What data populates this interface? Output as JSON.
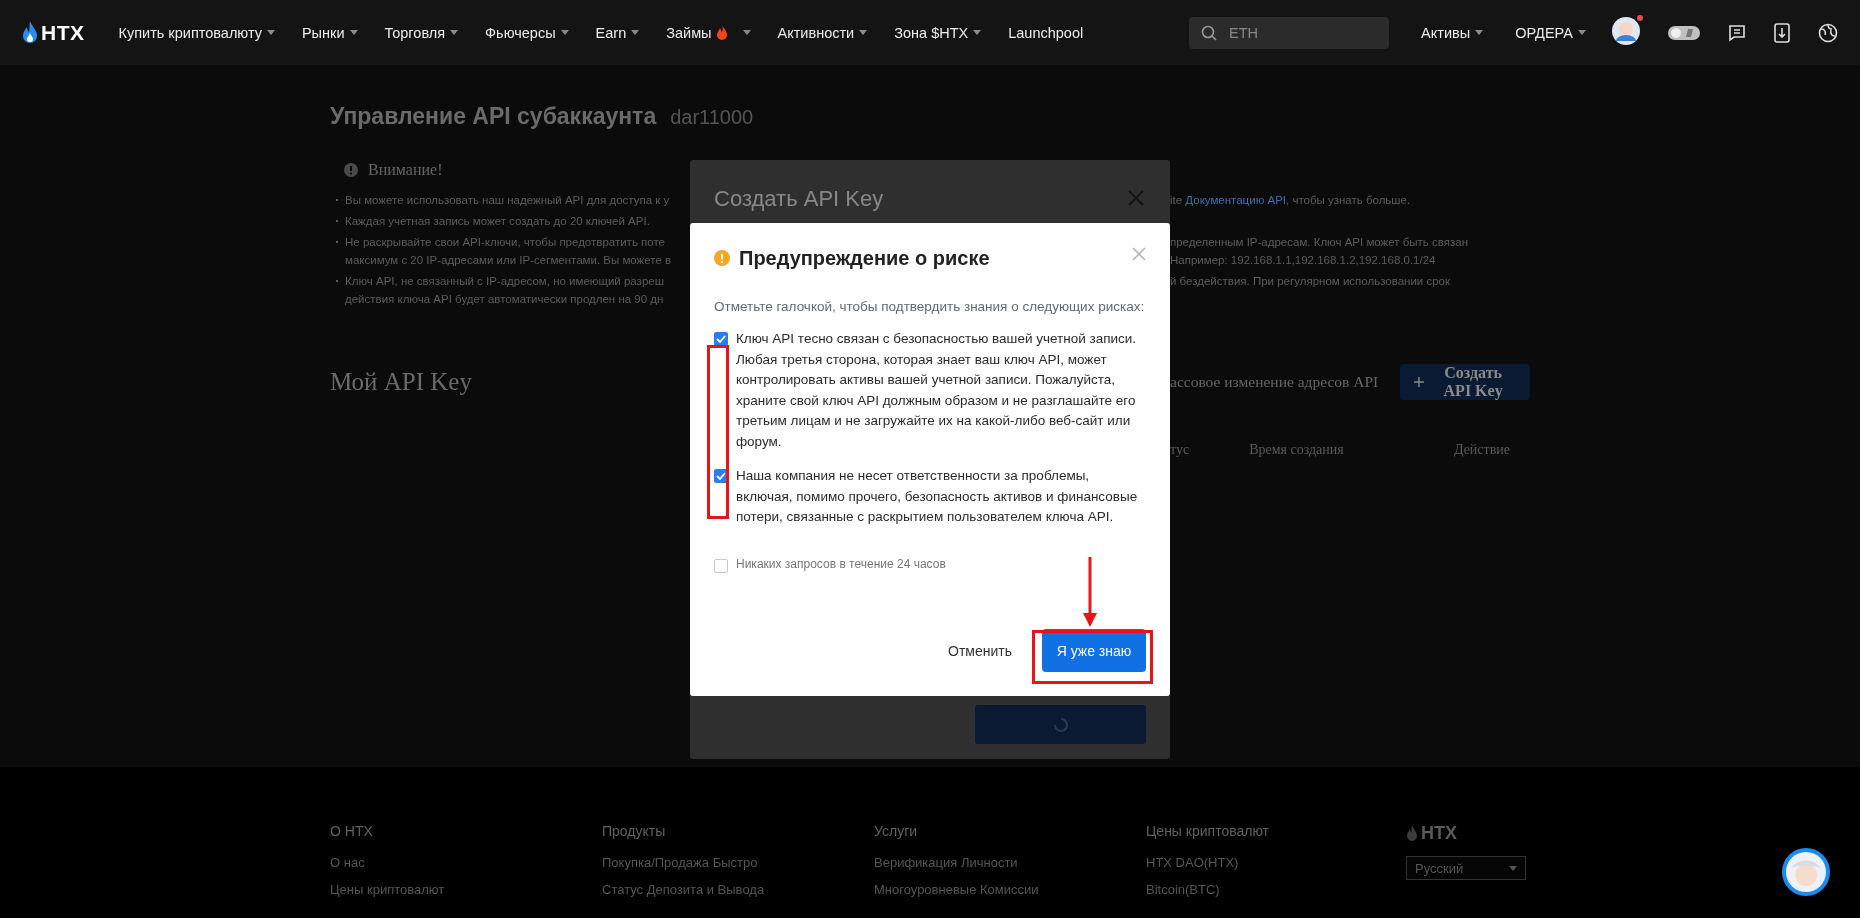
{
  "nav": {
    "logo": "HTX",
    "items": [
      {
        "label": "Купить криптовалюту",
        "kind": "menu"
      },
      {
        "label": "Рынки",
        "kind": "menu"
      },
      {
        "label": "Торговля",
        "kind": "menu"
      },
      {
        "label": "Фьючерсы",
        "kind": "menu"
      },
      {
        "label": "Earn",
        "kind": "menu"
      },
      {
        "label": "Займы",
        "kind": "menu-hot"
      },
      {
        "label": "Активности",
        "kind": "menu"
      },
      {
        "label": "Зона $HTX",
        "kind": "menu"
      },
      {
        "label": "Launchpool",
        "kind": "link"
      }
    ],
    "search": {
      "placeholder": "ETH"
    },
    "account_menus": [
      {
        "label": "Активы"
      },
      {
        "label": "ОРДЕРА"
      }
    ],
    "avatar": {
      "notification": true
    }
  },
  "page": {
    "title": "Управление API субаккаунта",
    "subaccount": "dar11000",
    "notice": {
      "title": "Внимание!",
      "lines": [
        {
          "bullet": true,
          "left": "Вы можете использовать наш надежный API для доступа к у",
          "right_start": "ite",
          "right_link": "Документацию API",
          "right": ", чтобы узнать больше."
        },
        {
          "bullet": true,
          "left": "Каждая учетная запись может создать до 20 ключей API."
        },
        {
          "bullet": true,
          "left": "Не раскрывайте свои API-ключи, чтобы предотвратить поте",
          "right": "пределенным IP-адресам. Ключ API может быть связан"
        },
        {
          "bullet": false,
          "left": "максимум с 20 IP-адресами или IP-сегментами. Вы можете в",
          "right": "Например: 192.168.1.1,192.168.1.2,192.168.0.1/24"
        },
        {
          "bullet": true,
          "left": "Ключ API, не связанный с IP-адресом, но имеющий разреш",
          "right": "й бездействия. При регулярном использовании срок"
        },
        {
          "bullet": false,
          "left": "действия ключа API будет автоматически продлен на 90 дн"
        }
      ]
    },
    "keys": {
      "title": "Мой API Key",
      "bulk_edit": "ассовое изменение адресов API",
      "create_button": "Создать API Key"
    },
    "table_columns": [
      "тус",
      "Время создания",
      "Действие"
    ]
  },
  "create_dialog": {
    "title": "Создать API Key"
  },
  "risk_dialog": {
    "title": "Предупреждение о риске",
    "intro": "Отметьте галочкой, чтобы подтвердить знания о следующих рисках:",
    "items": [
      {
        "text": "Ключ API тесно связан с безопасностью вашей учетной записи. Любая третья сторона, которая знает ваш ключ API, может контролировать активы вашей учетной записи. Пожалуйста, храните свой ключ API должным образом и не разглашайте его третьим лицам и не загружайте их на какой-либо веб-сайт или форум.",
        "checked": true
      },
      {
        "text": "Наша компания не несет ответственности за проблемы, включая, помимо прочего, безопасность активов и финансовые потери, связанные с раскрытием пользователем ключа API.",
        "checked": true
      }
    ],
    "option": {
      "label": "Никаких запросов в течение 24 часов",
      "checked": false
    },
    "cancel": "Отменить",
    "confirm": "Я уже знаю"
  },
  "footer": {
    "columns": [
      {
        "heading": "О HTX",
        "links": [
          "О нас",
          "Цены криптовалют"
        ]
      },
      {
        "heading": "Продукты",
        "links": [
          "Покупка/Продажа Быстро",
          "Статус Депозита и Вывода"
        ]
      },
      {
        "heading": "Услуги",
        "links": [
          "Верификация Личности",
          "Многоуровневые Комиссии"
        ]
      },
      {
        "heading": "Цены криптовалют",
        "links": [
          "HTX DAO(HTX)",
          "Bitcoin(BTC)"
        ]
      }
    ],
    "logo": "HTX",
    "language": "Русский"
  }
}
